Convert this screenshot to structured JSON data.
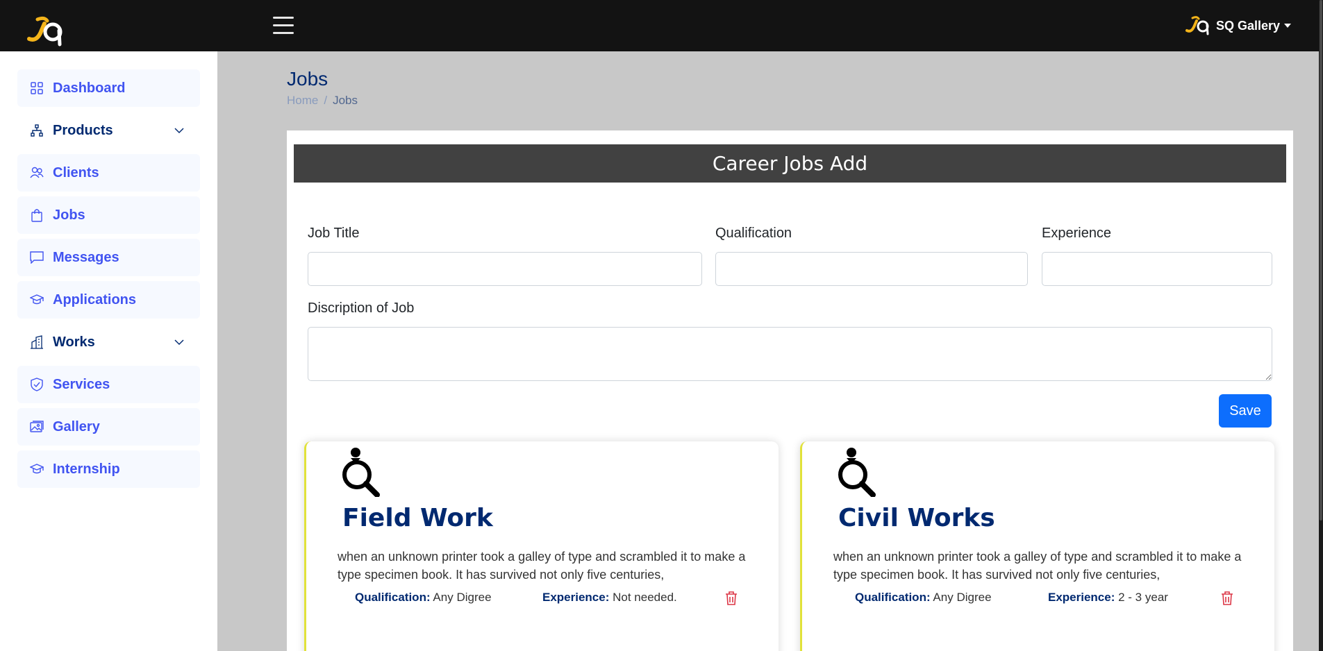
{
  "header": {
    "brand_colors": {
      "topbar": "#131313",
      "accent": "#f4b41a"
    },
    "user_name": "SQ Gallery"
  },
  "sidebar": {
    "items": [
      {
        "label": "Dashboard",
        "icon": "grid-icon"
      },
      {
        "label": "Products",
        "icon": "diagram-icon",
        "expandable": true
      },
      {
        "label": "Clients",
        "icon": "people-icon"
      },
      {
        "label": "Jobs",
        "icon": "bag-icon"
      },
      {
        "label": "Messages",
        "icon": "chat-icon"
      },
      {
        "label": "Applications",
        "icon": "mortarboard-icon"
      },
      {
        "label": "Works",
        "icon": "building-icon",
        "expandable": true
      },
      {
        "label": "Services",
        "icon": "shield-check-icon"
      },
      {
        "label": "Gallery",
        "icon": "images-icon"
      },
      {
        "label": "Internship",
        "icon": "mortarboard-icon"
      }
    ]
  },
  "page": {
    "title": "Jobs",
    "breadcrumb": {
      "home": "Home",
      "separator": "/",
      "current": "Jobs"
    }
  },
  "form": {
    "header": "Career Jobs Add",
    "job_title_label": "Job Title",
    "job_title_value": "",
    "qualification_label": "Qualification",
    "qualification_value": "",
    "experience_label": "Experience",
    "experience_value": "",
    "description_label": "Discription of Job",
    "description_value": "",
    "save_label": "Save"
  },
  "jobs": [
    {
      "title": "Field Work",
      "description": "when an unknown printer took a galley of type and scrambled it to make a type specimen book. It has survived not only five centuries,",
      "qualification_label": "Qualification:",
      "qualification": "Any Digree",
      "experience_label": "Experience:",
      "experience": "Not needed."
    },
    {
      "title": "Civil Works",
      "description": "when an unknown printer took a galley of type and scrambled it to make a type specimen book. It has survived not only five centuries,",
      "qualification_label": "Qualification:",
      "qualification": "Any Digree",
      "experience_label": "Experience:",
      "experience": "2 - 3 year"
    }
  ]
}
